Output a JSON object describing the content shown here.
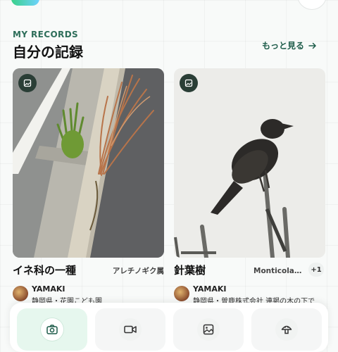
{
  "section": {
    "eyebrow": "MY RECORDS",
    "title": "自分の記録",
    "more_label": "もっと見る"
  },
  "records": [
    {
      "name": "イネ科の一種",
      "genus": "アレチノギク属",
      "user": "YAMAKI",
      "location": "静岡県・花園こども園"
    },
    {
      "name": "針葉樹",
      "genus": "Monticola属…",
      "extra_count": "+1",
      "user": "YAMAKI",
      "location": "静岡県・曽鹿株式会社 連掲の木の下で"
    }
  ],
  "bottom_nav": [
    {
      "icon": "camera-icon",
      "active": true
    },
    {
      "icon": "video-icon",
      "active": false
    },
    {
      "icon": "image-icon",
      "active": false
    },
    {
      "icon": "mushroom-icon",
      "active": false
    }
  ],
  "colors": {
    "accent": "#2e6e5a",
    "link": "#1e5c4a",
    "active_nav_bg": "#e6f7ee",
    "badge_bg": "#2a3e36"
  }
}
